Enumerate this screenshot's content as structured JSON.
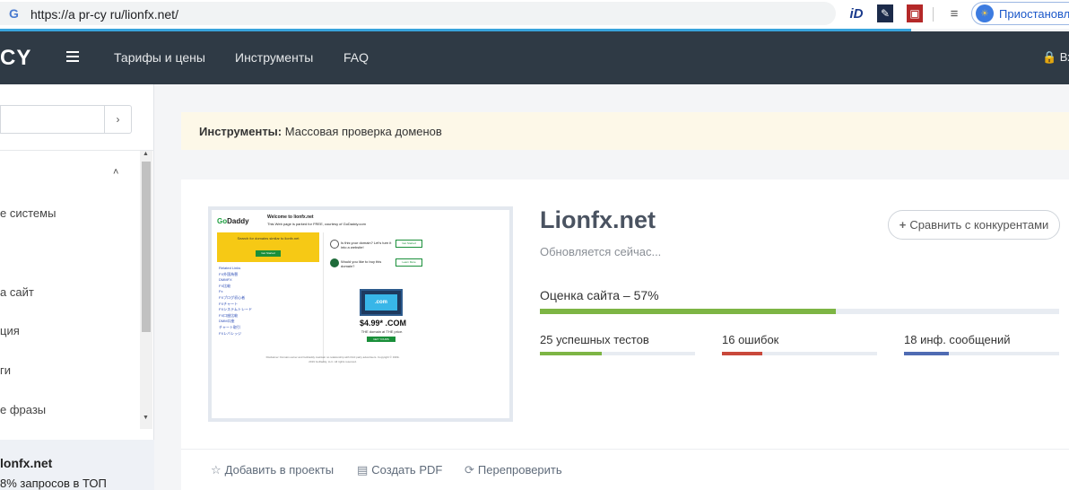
{
  "browser": {
    "url": "https://a pr-cy ru/lionfx.net/",
    "google_glyph": "G",
    "ext_id_glyph": "iD",
    "ext_pen_glyph": "✎",
    "ext_red_glyph": "▣",
    "ext_list_glyph": "≡",
    "pause_label": "Приостановле",
    "pause_avatar_glyph": "☀",
    "accent": "#38a4dc"
  },
  "nav": {
    "logo": "CY",
    "links": [
      "Тарифы и цены",
      "Инструменты",
      "FAQ"
    ],
    "login": "🔒 Вход",
    "bg": "#2f3a45"
  },
  "sidebar": {
    "search_placeholder": "",
    "search_go": "›",
    "caret": "˄",
    "items": [
      "е системы",
      "а сайт",
      "ция",
      "ги",
      "е фразы"
    ],
    "domain": "lonfx.net",
    "top_text": "8% запросов в ТОП"
  },
  "breadcrumb": {
    "label": "Инструменты:",
    "text": "Массовая проверка доменов"
  },
  "thumbnail": {
    "logo_go": "Go",
    "logo_daddy": "Daddy",
    "welcome": "Welcome to lionfx.net",
    "parked": "This Web page is parked for FREE, courtesy of GoDaddy.com",
    "yellow_text": "Search for domains similar to lionfx.net",
    "yellow_btn": "Get Started",
    "links": [
      "Related Links",
      "FX外国為替",
      "DMMFX",
      "FX比較",
      "Fx",
      "FXブログ初心者",
      "FXチャート",
      "FXシステムトレード",
      "FX口座比較",
      "DMM口座",
      "チャート取引",
      "FXレバレッジ"
    ],
    "q1": "Is this your domain? Let's turn it into a website!",
    "q1_btn": "Get Started",
    "q2": "Would you like to buy this domain?",
    "q2_btn": "Learn More",
    "laptop_screen": ".com",
    "price": "$4.99* .COM",
    "price_sub": "THE domain at THE price.",
    "price_btn": "GET YOURS",
    "footer": "Disclaimer: Domain owner and GoDaddy maintain no relationship with third party advertisers. Copyright © 1999-2019 GoDaddy, LLC. All rights reserved."
  },
  "site": {
    "title": "Lionfx.net",
    "status": "Обновляется сейчас...",
    "compare_plus": "+",
    "compare_label": "Сравнить с конкурентами",
    "score_label": "Оценка сайта – 57%",
    "score_fraction": 0.57,
    "score_color": "#7db544"
  },
  "stats": [
    {
      "label": "25 успешных тестов",
      "fraction": 0.4,
      "color": "#7db544"
    },
    {
      "label": "16 ошибок",
      "fraction": 0.26,
      "color": "#c9483b"
    },
    {
      "label": "18 инф. сообщений",
      "fraction": 0.29,
      "color": "#4f6bb3"
    }
  ],
  "actions": {
    "add_icon": "☆",
    "add_label": "Добавить в проекты",
    "pdf_icon": "▤",
    "pdf_label": "Создать PDF",
    "recheck_icon": "⟳",
    "recheck_label": "Перепроверить"
  }
}
